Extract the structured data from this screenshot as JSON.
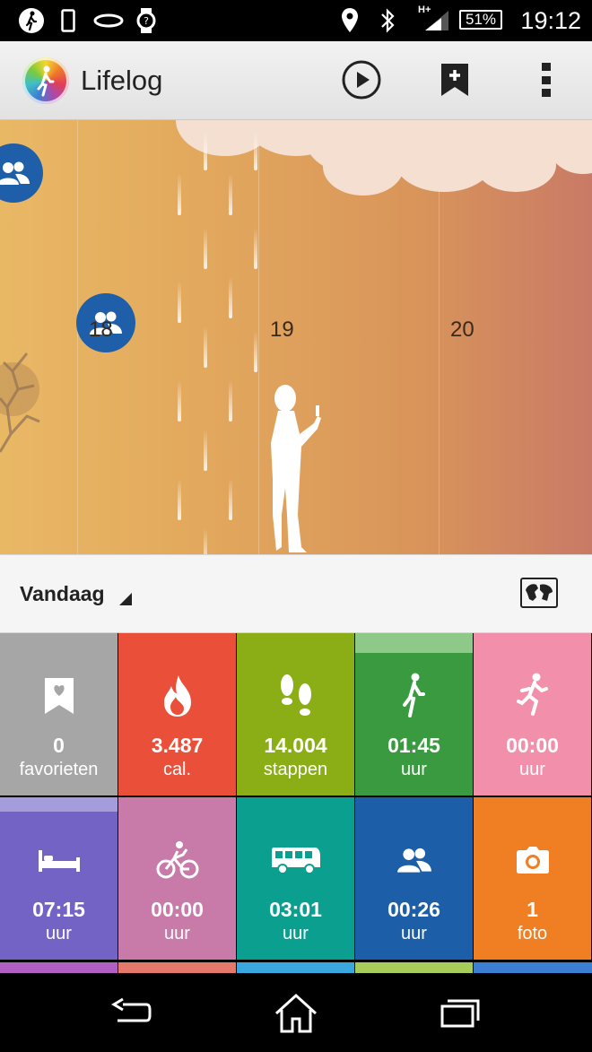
{
  "status_bar": {
    "network": "H+",
    "battery": "51%",
    "time": "19:12"
  },
  "action_bar": {
    "title": "Lifelog"
  },
  "timeline": {
    "days": [
      "18",
      "19",
      "20"
    ]
  },
  "date_selector": {
    "label": "Vandaag"
  },
  "tiles": [
    {
      "value": "0",
      "unit": "favorieten",
      "icon": "bookmark-heart-icon",
      "color": "#a6a6a6"
    },
    {
      "value": "3.487",
      "unit": "cal.",
      "icon": "flame-icon",
      "color": "#ea4f3a"
    },
    {
      "value": "14.004",
      "unit": "stappen",
      "icon": "footsteps-icon",
      "color": "#8bad16"
    },
    {
      "value": "01:45",
      "unit": "uur",
      "icon": "walking-icon",
      "color": "#3a9a3f"
    },
    {
      "value": "00:00",
      "unit": "uur",
      "icon": "running-icon",
      "color": "#f28fab"
    },
    {
      "value": "07:15",
      "unit": "uur",
      "icon": "bed-icon",
      "color": "#7363c4"
    },
    {
      "value": "00:00",
      "unit": "uur",
      "icon": "bicycle-icon",
      "color": "#c87aa8"
    },
    {
      "value": "03:01",
      "unit": "uur",
      "icon": "bus-icon",
      "color": "#0a9f8e"
    },
    {
      "value": "00:26",
      "unit": "uur",
      "icon": "people-icon",
      "color": "#1c5ea7"
    },
    {
      "value": "1",
      "unit": "foto",
      "icon": "camera-icon",
      "color": "#f07e23"
    }
  ]
}
